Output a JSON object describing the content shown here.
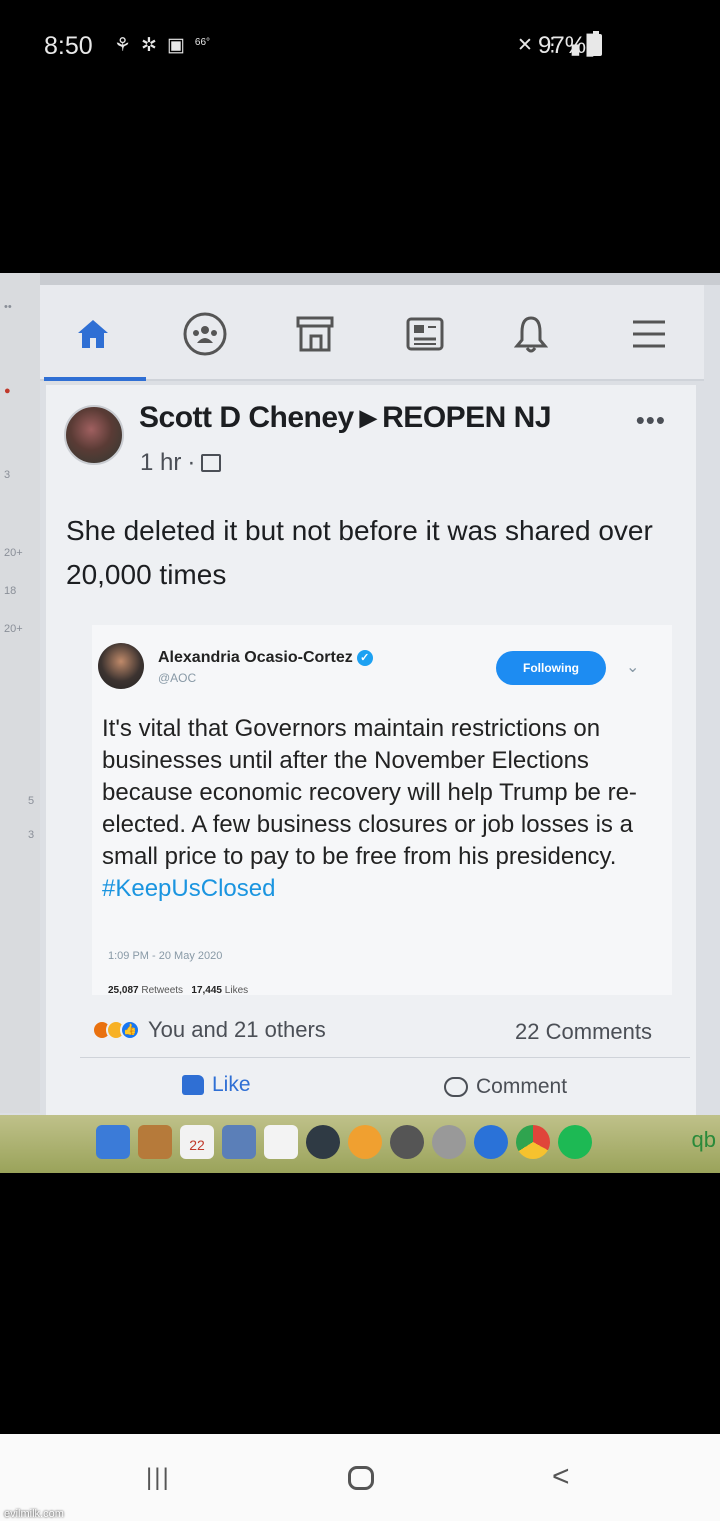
{
  "status_bar": {
    "time": "8:50",
    "temp": "66°",
    "battery": "97%"
  },
  "left_gutter": [
    "3",
    "20+",
    "18",
    "20+",
    "5",
    "3"
  ],
  "post": {
    "author": "Scott D Cheney",
    "group": "REOPEN NJ",
    "time": "1 hr",
    "more": "•••",
    "text": "She deleted it but not before it was shared over 20,000 times",
    "tweet": {
      "name": "Alexandria Ocasio-Cortez",
      "handle": "@AOC",
      "follow_label": "Following",
      "body": "It's vital that Governors maintain restrictions on businesses until after the November Elections because economic recovery will help Trump be re-elected. A few business closures or job losses is a small price to pay to be free from his presidency.",
      "hashtag": "#KeepUsClosed",
      "date": "1:09 PM - 20 May 2020",
      "retweets": "25,087",
      "retweets_label": "Retweets",
      "likes": "17,445",
      "likes_label": "Likes"
    },
    "reactions_text": "You and 21 others",
    "comments_count": "22 Comments",
    "like_label": "Like",
    "comment_label": "Comment"
  },
  "dock": {
    "calendar_day": "22",
    "end_label": "qb"
  },
  "watermark": "evilmilk.com",
  "icons": [
    "home-icon",
    "groups-icon",
    "marketplace-icon",
    "news-icon",
    "bell-icon",
    "menu-icon"
  ],
  "colors": {
    "facebook_blue": "#2f6fd4",
    "twitter_blue": "#1d8cf2",
    "hashtag": "#1b95e0"
  }
}
